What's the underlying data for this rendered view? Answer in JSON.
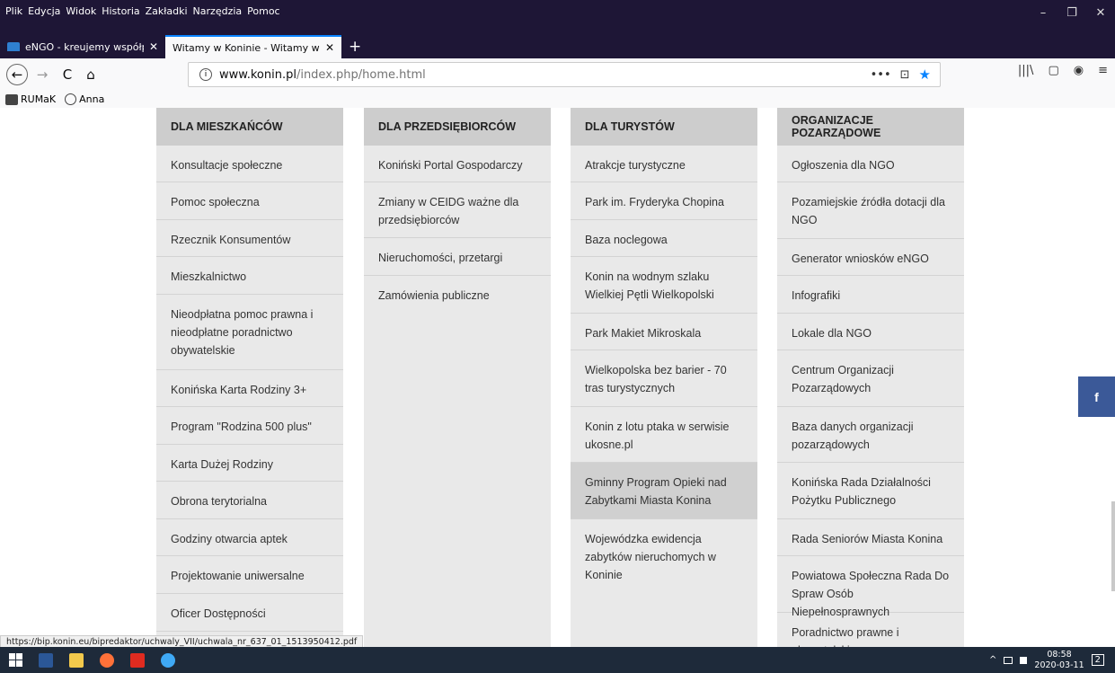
{
  "menubar": {
    "items": [
      "Plik",
      "Edycja",
      "Widok",
      "Historia",
      "Zakładki",
      "Narzędzia",
      "Pomoc"
    ],
    "window_controls": [
      "–",
      "❐",
      "✕"
    ]
  },
  "tabs": [
    {
      "title": "eNGO - kreujemy współpracę",
      "close": "✕"
    },
    {
      "title": "Witamy w Koninie - Witamy w Koni",
      "close": "✕"
    }
  ],
  "newtab_label": "+",
  "navbar": {
    "back": "←",
    "forward": "→",
    "reload": "C",
    "home": "⌂",
    "url_host": "www.konin.pl",
    "url_path": "/index.php/home.html",
    "page_actions": "•••",
    "pocket": "⊡",
    "star": "★",
    "library": "|||\\",
    "sidebar": "▢",
    "account": "◉",
    "menu": "≡"
  },
  "bookmarks": [
    {
      "label": "RUMaK",
      "icon": "folder-icon"
    },
    {
      "label": "Anna",
      "icon": "globe-icon"
    }
  ],
  "columns": [
    {
      "header": "DLA MIESZKAŃCÓW",
      "items": [
        "Konsultacje społeczne",
        "Pomoc społeczna",
        "Rzecznik Konsumentów",
        "Mieszkalnictwo",
        "Nieodpłatna pomoc prawna i nieodpłatne poradnictwo obywatelskie",
        "Konińska Karta Rodziny 3+",
        "Program \"Rodzina 500 plus\"",
        "Karta Dużej Rodziny",
        "Obrona terytorialna",
        "Godziny otwarcia aptek",
        "Projektowanie uniwersalne",
        "Oficer Dostępności"
      ]
    },
    {
      "header": "DLA PRZEDSIĘBIORCÓW",
      "items": [
        "Koniński Portal Gospodarczy",
        "Zmiany w CEIDG ważne dla przedsiębiorców",
        "Nieruchomości, przetargi",
        "Zamówienia publiczne"
      ]
    },
    {
      "header": "DLA TURYSTÓW",
      "items": [
        "Atrakcje turystyczne",
        "Park im. Fryderyka Chopina",
        "Baza noclegowa",
        "Konin na wodnym szlaku Wielkiej Pętli Wielkopolski",
        "Park Makiet Mikroskala",
        "Wielkopolska bez barier - 70 tras turystycznych",
        "Konin z lotu ptaka w serwisie ukosne.pl",
        "Gminny Program Opieki nad Zabytkami Miasta Konina",
        "Wojewódzka ewidencja zabytków nieruchomych w Koninie"
      ]
    },
    {
      "header": "ORGANIZACJE POZARZĄDOWE",
      "items": [
        "Ogłoszenia dla NGO",
        "Pozamiejskie źródła dotacji dla NGO",
        "Generator wniosków eNGO",
        "Infografiki",
        "Lokale dla NGO",
        "Centrum Organizacji Pozarządowych",
        "Baza danych organizacji pozarządowych",
        "Konińska Rada Działalności Pożytku Publicznego",
        "Rada Seniorów Miasta Konina",
        "Powiatowa Społeczna Rada Do Spraw Osób Niepełnosprawnych",
        "Poradnictwo prawne i obywatelskie"
      ]
    }
  ],
  "facebook_label": "f",
  "status_url": "https://bip.konin.eu/bipredaktor/uchwaly_VII/uchwala_nr_637_01_1513950412.pdf",
  "taskbar": {
    "time": "08:58",
    "date": "2020-03-11",
    "tray_arrow": "^",
    "notifications": "2"
  },
  "colors": {
    "header_bg": "#cdcdcd",
    "item_bg": "#e9e9e9",
    "facebook": "#3b5998",
    "accent": "#0a84ff"
  }
}
